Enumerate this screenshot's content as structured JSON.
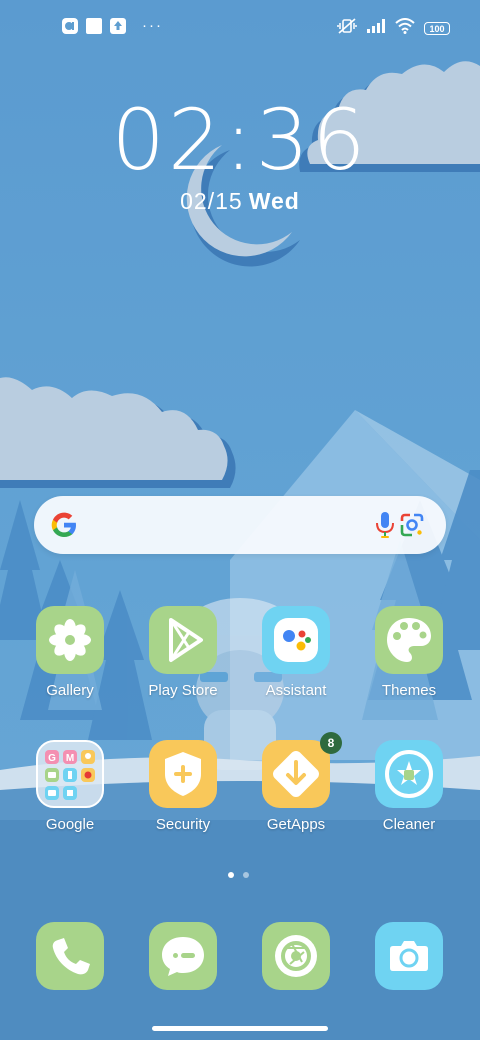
{
  "status_bar": {
    "left_icons": [
      "notification-app-icon",
      "notification-square-icon",
      "notification-upload-icon"
    ],
    "overflow": "···",
    "right_icons": [
      "vibrate-off-icon",
      "signal-icon",
      "wifi-icon"
    ],
    "battery": "100"
  },
  "clock": {
    "time": "02:36",
    "date": "02/15",
    "weekday": "Wed"
  },
  "search": {
    "provider": "Google"
  },
  "apps": [
    {
      "label": "Gallery",
      "icon": "gallery-icon"
    },
    {
      "label": "Play Store",
      "icon": "play-store-icon"
    },
    {
      "label": "Assistant",
      "icon": "assistant-icon"
    },
    {
      "label": "Themes",
      "icon": "themes-icon"
    },
    {
      "label": "Google",
      "icon": "google-folder-icon"
    },
    {
      "label": "Security",
      "icon": "security-icon"
    },
    {
      "label": "GetApps",
      "icon": "getapps-icon",
      "badge": "8"
    },
    {
      "label": "Cleaner",
      "icon": "cleaner-icon"
    }
  ],
  "dock": [
    {
      "name": "phone",
      "icon": "phone-icon"
    },
    {
      "name": "messages",
      "icon": "messages-icon"
    },
    {
      "name": "browser",
      "icon": "browser-icon"
    },
    {
      "name": "camera",
      "icon": "camera-icon"
    }
  ],
  "pager": {
    "pages": 2,
    "active": 1
  },
  "colors": {
    "green_icon": "#a8d48a",
    "yellow_icon": "#f9c85a",
    "cyan_icon": "#6fd3f2",
    "sky": "#5e9ed0"
  }
}
